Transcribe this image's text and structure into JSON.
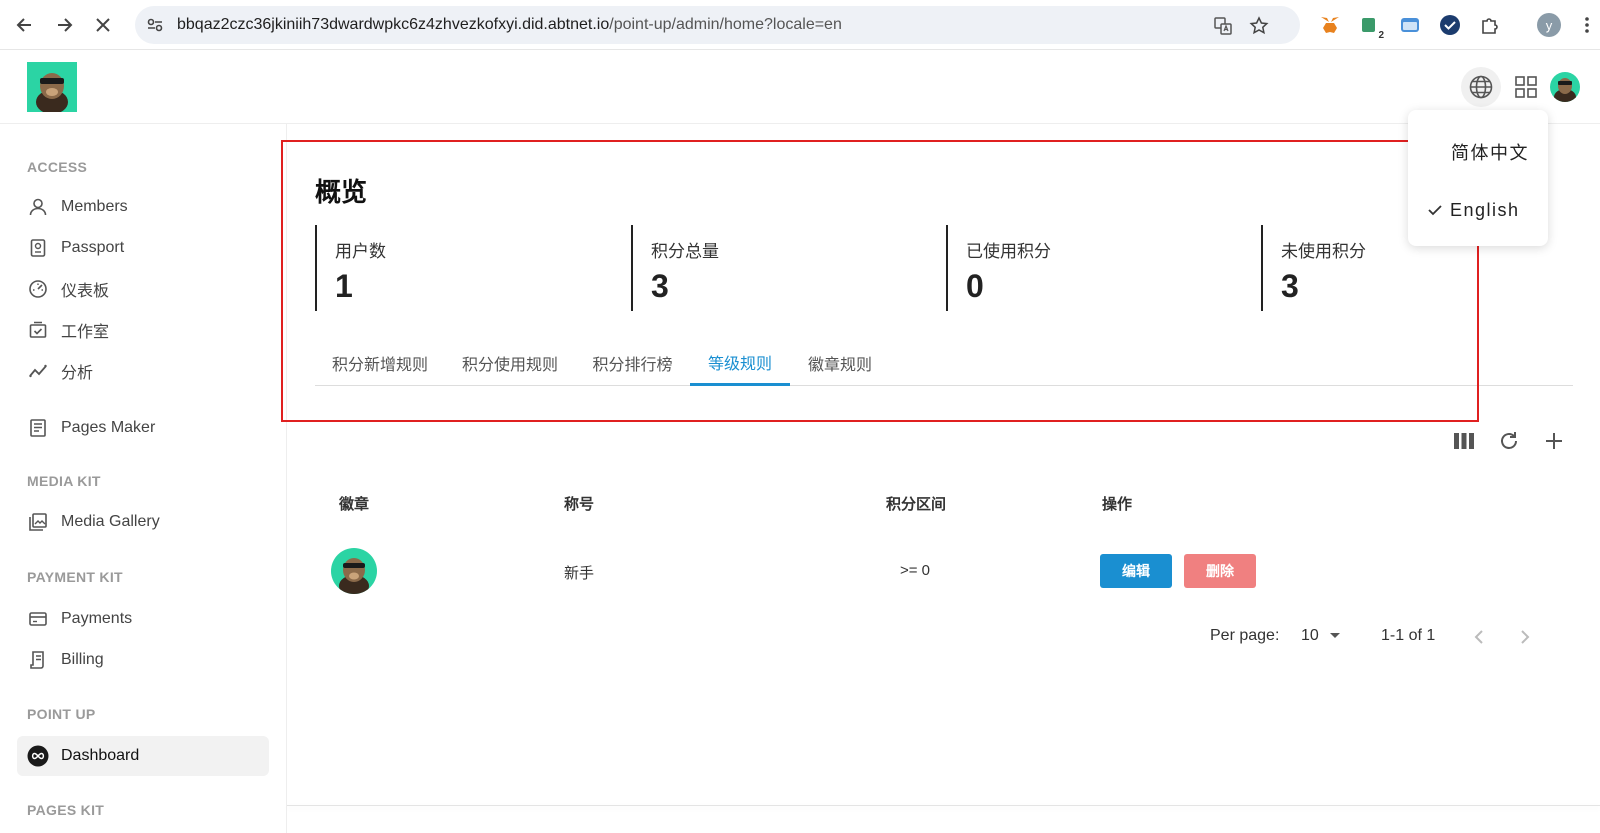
{
  "browser": {
    "url_host": "bbqaz2czc36jkiniih73dwardwpkc6z4zhvezkofxyi.did.abtnet.io",
    "url_path": "/point-up/admin/home?locale=en",
    "profile_initial": "y",
    "ext_badge": "2"
  },
  "sidebar": {
    "sections": [
      {
        "title": "ACCESS"
      },
      {
        "title": "MEDIA KIT"
      },
      {
        "title": "PAYMENT KIT"
      },
      {
        "title": "POINT UP"
      },
      {
        "title": "PAGES KIT"
      }
    ],
    "items": [
      {
        "label": "Members",
        "icon": "user-icon"
      },
      {
        "label": "Passport",
        "icon": "passport-icon"
      },
      {
        "label": "仪表板",
        "icon": "gauge-icon"
      },
      {
        "label": "工作室",
        "icon": "studio-icon"
      },
      {
        "label": "分析",
        "icon": "analytics-icon"
      },
      {
        "label": "Pages Maker",
        "icon": "pages-icon"
      },
      {
        "label": "Media Gallery",
        "icon": "gallery-icon"
      },
      {
        "label": "Payments",
        "icon": "card-icon"
      },
      {
        "label": "Billing",
        "icon": "billing-icon"
      },
      {
        "label": "Dashboard",
        "icon": "infinity-icon"
      }
    ]
  },
  "overview": {
    "title": "概览",
    "stats": [
      {
        "label": "用户数",
        "value": "1"
      },
      {
        "label": "积分总量",
        "value": "3"
      },
      {
        "label": "已使用积分",
        "value": "0"
      },
      {
        "label": "未使用积分",
        "value": "3"
      }
    ]
  },
  "tabs": [
    {
      "label": "积分新增规则"
    },
    {
      "label": "积分使用规则"
    },
    {
      "label": "积分排行榜"
    },
    {
      "label": "等级规则",
      "active": true
    },
    {
      "label": "徽章规则"
    }
  ],
  "table": {
    "headers": [
      "徽章",
      "称号",
      "积分区间",
      "操作"
    ],
    "rows": [
      {
        "title": "新手",
        "range": ">= 0",
        "edit_label": "编辑",
        "delete_label": "删除"
      }
    ]
  },
  "pagination": {
    "per_page_label": "Per page:",
    "per_page_value": "10",
    "range_text": "1-1 of 1"
  },
  "language_menu": {
    "options": [
      {
        "label": "简体中文"
      },
      {
        "label": "English",
        "selected": true
      }
    ]
  },
  "colors": {
    "accent": "#1a8fd1",
    "danger": "#f08080",
    "highlight": "#e02020"
  }
}
